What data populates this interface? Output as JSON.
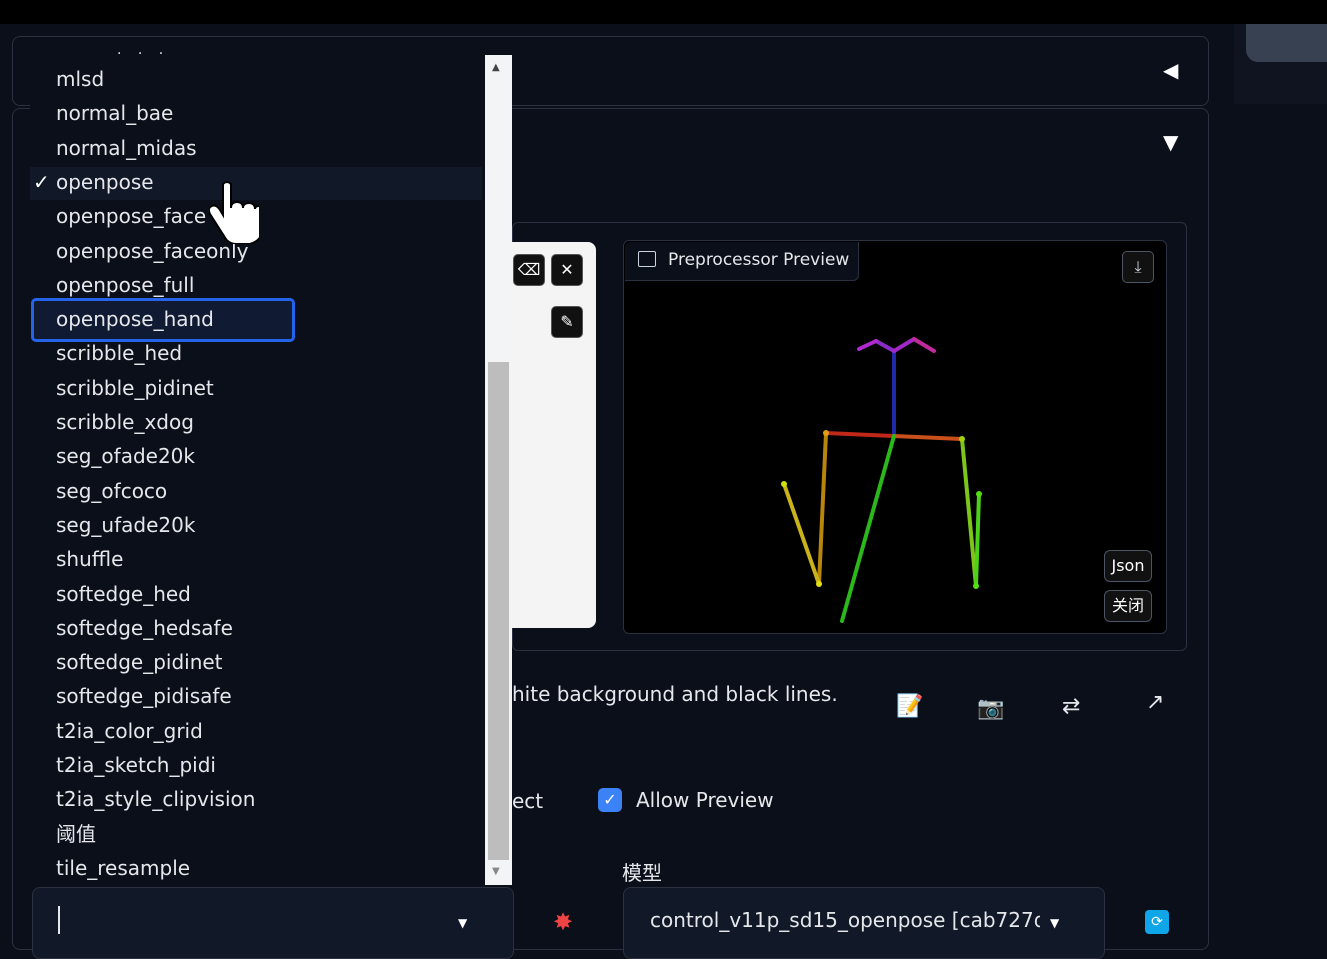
{
  "colors": {
    "accent": "#2563eb",
    "checkbox": "#3b82f6",
    "background": "#0b0f19"
  },
  "dropdown": {
    "partial_top": ". . .",
    "items": [
      {
        "label": "mlsd",
        "checked": false
      },
      {
        "label": "normal_bae",
        "checked": false
      },
      {
        "label": "normal_midas",
        "checked": false
      },
      {
        "label": "openpose",
        "checked": true
      },
      {
        "label": "openpose_face",
        "checked": false
      },
      {
        "label": "openpose_faceonly",
        "checked": false
      },
      {
        "label": "openpose_full",
        "checked": false
      },
      {
        "label": "openpose_hand",
        "checked": false,
        "highlighted": true
      },
      {
        "label": "scribble_hed",
        "checked": false
      },
      {
        "label": "scribble_pidinet",
        "checked": false
      },
      {
        "label": "scribble_xdog",
        "checked": false
      },
      {
        "label": "seg_ofade20k",
        "checked": false
      },
      {
        "label": "seg_ofcoco",
        "checked": false
      },
      {
        "label": "seg_ufade20k",
        "checked": false
      },
      {
        "label": "shuffle",
        "checked": false
      },
      {
        "label": "softedge_hed",
        "checked": false
      },
      {
        "label": "softedge_hedsafe",
        "checked": false
      },
      {
        "label": "softedge_pidinet",
        "checked": false
      },
      {
        "label": "softedge_pidisafe",
        "checked": false
      },
      {
        "label": "t2ia_color_grid",
        "checked": false
      },
      {
        "label": "t2ia_sketch_pidi",
        "checked": false
      },
      {
        "label": "t2ia_style_clipvision",
        "checked": false
      },
      {
        "label": "阈值",
        "checked": false
      },
      {
        "label": "tile_resample",
        "checked": false
      }
    ],
    "check_mark": "✓"
  },
  "image_tools": {
    "eraser": "⌫",
    "close": "✕",
    "brush": "✎"
  },
  "preview": {
    "title": "Preprocessor Preview",
    "download_icon": "⤓",
    "json_button": "Json",
    "close_button": "关闭"
  },
  "description": "hite background and black lines.",
  "actions": {
    "edit": "📝",
    "camera": "📷",
    "swap": "⇄",
    "send": "↗"
  },
  "options": {
    "pixel_perfect_partial": "ect",
    "allow_preview_label": "Allow Preview",
    "allow_preview_checked": true
  },
  "model": {
    "title": "模型",
    "selected": "control_v11p_sd15_openpose [cab727d",
    "preprocessor_value": ""
  },
  "icons": {
    "collapse_left": "◀",
    "collapse_down": "▼",
    "fire": "✸",
    "refresh": "🔄"
  }
}
